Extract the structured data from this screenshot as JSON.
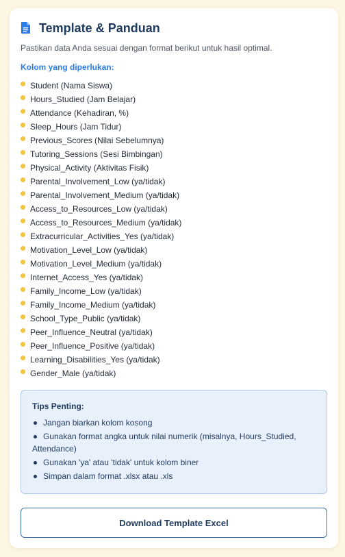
{
  "header": {
    "title": "Template & Panduan",
    "icon": "document-icon",
    "subtitle": "Pastikan data Anda sesuai dengan format berikut untuk hasil optimal."
  },
  "columns": {
    "heading": "Kolom yang diperlukan:",
    "items": [
      "Student (Nama Siswa)",
      "Hours_Studied (Jam Belajar)",
      "Attendance (Kehadiran, %)",
      "Sleep_Hours (Jam Tidur)",
      "Previous_Scores (Nilai Sebelumnya)",
      "Tutoring_Sessions (Sesi Bimbingan)",
      "Physical_Activity (Aktivitas Fisik)",
      "Parental_Involvement_Low (ya/tidak)",
      "Parental_Involvement_Medium (ya/tidak)",
      "Access_to_Resources_Low (ya/tidak)",
      "Access_to_Resources_Medium (ya/tidak)",
      "Extracurricular_Activities_Yes (ya/tidak)",
      "Motivation_Level_Low (ya/tidak)",
      "Motivation_Level_Medium (ya/tidak)",
      "Internet_Access_Yes (ya/tidak)",
      "Family_Income_Low (ya/tidak)",
      "Family_Income_Medium (ya/tidak)",
      "School_Type_Public (ya/tidak)",
      "Peer_Influence_Neutral (ya/tidak)",
      "Peer_Influence_Positive (ya/tidak)",
      "Learning_Disabilities_Yes (ya/tidak)",
      "Gender_Male (ya/tidak)"
    ]
  },
  "tips": {
    "title": "Tips Penting:",
    "items": [
      "Jangan biarkan kolom kosong",
      "Gunakan format angka untuk nilai numerik (misalnya, Hours_Studied, Attendance)",
      "Gunakan 'ya' atau 'tidak' untuk kolom biner",
      "Simpan dalam format .xlsx atau .xls"
    ]
  },
  "download": {
    "label": "Download Template Excel"
  },
  "colors": {
    "accent": "#2b7de9",
    "bullet": "#f5c342",
    "heading": "#1e3a5f",
    "tips_bg": "#e8f0fc",
    "page_bg": "#fdf6e3"
  }
}
